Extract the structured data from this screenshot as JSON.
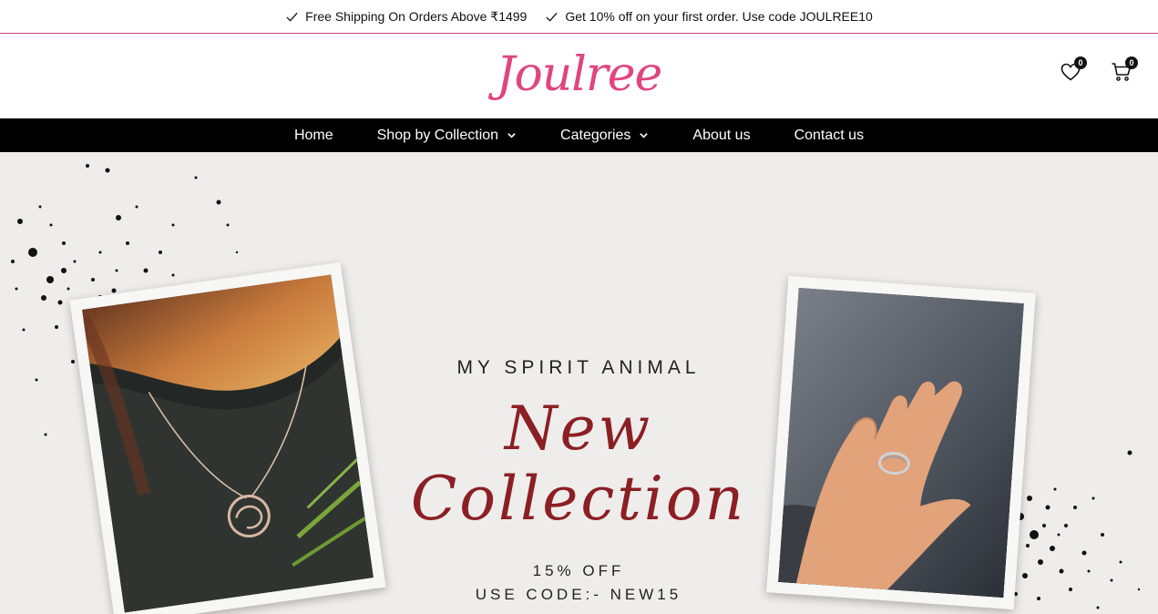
{
  "announcement": {
    "items": [
      "Free Shipping On Orders Above ₹1499",
      "Get 10% off on your first order. Use code JOULREE10"
    ]
  },
  "header": {
    "logo_text": "Joulree",
    "wishlist_count": "0",
    "cart_count": "0"
  },
  "nav": {
    "items": [
      {
        "label": "Home",
        "has_dropdown": false
      },
      {
        "label": "Shop by Collection",
        "has_dropdown": true
      },
      {
        "label": "Categories",
        "has_dropdown": true
      },
      {
        "label": "About us",
        "has_dropdown": false
      },
      {
        "label": "Contact us",
        "has_dropdown": false
      }
    ]
  },
  "hero": {
    "kicker": "MY SPIRIT ANIMAL",
    "title": "New Collection",
    "offer_line1": "15% OFF",
    "offer_line2": "USE CODE:- NEW15"
  },
  "colors": {
    "brand": "#e0457f",
    "title": "#8b1f24",
    "nav_bg": "#000000",
    "hero_bg": "#eeedeb"
  }
}
